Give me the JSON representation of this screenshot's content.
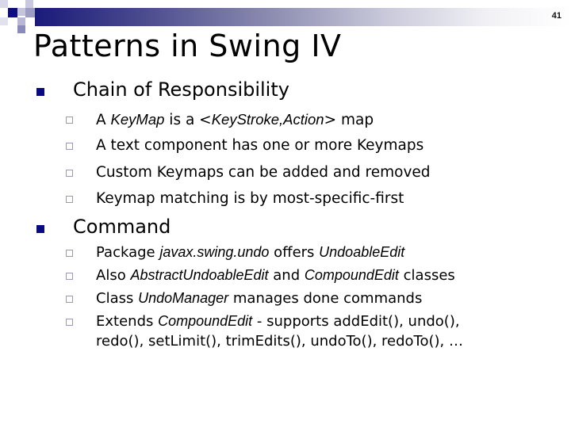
{
  "slide": {
    "number": "41",
    "title": "Patterns in Swing IV"
  },
  "sections": [
    {
      "heading": "Chain of Responsibility",
      "items": [
        {
          "parts": [
            {
              "t": "A ",
              "i": false
            },
            {
              "t": "KeyMap",
              "i": true
            },
            {
              "t": " is a <",
              "i": false
            },
            {
              "t": "KeyStroke,Action",
              "i": true
            },
            {
              "t": "> map",
              "i": false
            }
          ]
        },
        {
          "parts": [
            {
              "t": "A text component has one or more Keymaps",
              "i": false
            }
          ]
        },
        {
          "parts": [
            {
              "t": "Custom Keymaps can be added and removed",
              "i": false
            }
          ]
        },
        {
          "parts": [
            {
              "t": "Keymap matching is by most-specific-first",
              "i": false
            }
          ]
        }
      ]
    },
    {
      "heading": "Command",
      "items": [
        {
          "parts": [
            {
              "t": "Package ",
              "i": false
            },
            {
              "t": "javax.swing.undo",
              "i": true
            },
            {
              "t": " offers ",
              "i": false
            },
            {
              "t": "UndoableEdit",
              "i": true
            }
          ]
        },
        {
          "parts": [
            {
              "t": "Also ",
              "i": false
            },
            {
              "t": "AbstractUndoableEdit",
              "i": true
            },
            {
              "t": " and ",
              "i": false
            },
            {
              "t": "CompoundEdit",
              "i": true
            },
            {
              "t": " classes",
              "i": false
            }
          ]
        },
        {
          "parts": [
            {
              "t": "Class ",
              "i": false
            },
            {
              "t": "UndoManager",
              "i": true
            },
            {
              "t": " manages done commands",
              "i": false
            }
          ]
        },
        {
          "parts": [
            {
              "t": "Extends ",
              "i": false
            },
            {
              "t": "CompoundEdit",
              "i": true
            },
            {
              "t": " - supports addEdit(), undo(),",
              "i": false
            }
          ],
          "continuation": "redo(), setLimit(), trimEdits(), undoTo(), redoTo(), …"
        }
      ]
    }
  ],
  "colors": {
    "accent": "#0a0a80",
    "sub_bullet": "#9898b8"
  }
}
